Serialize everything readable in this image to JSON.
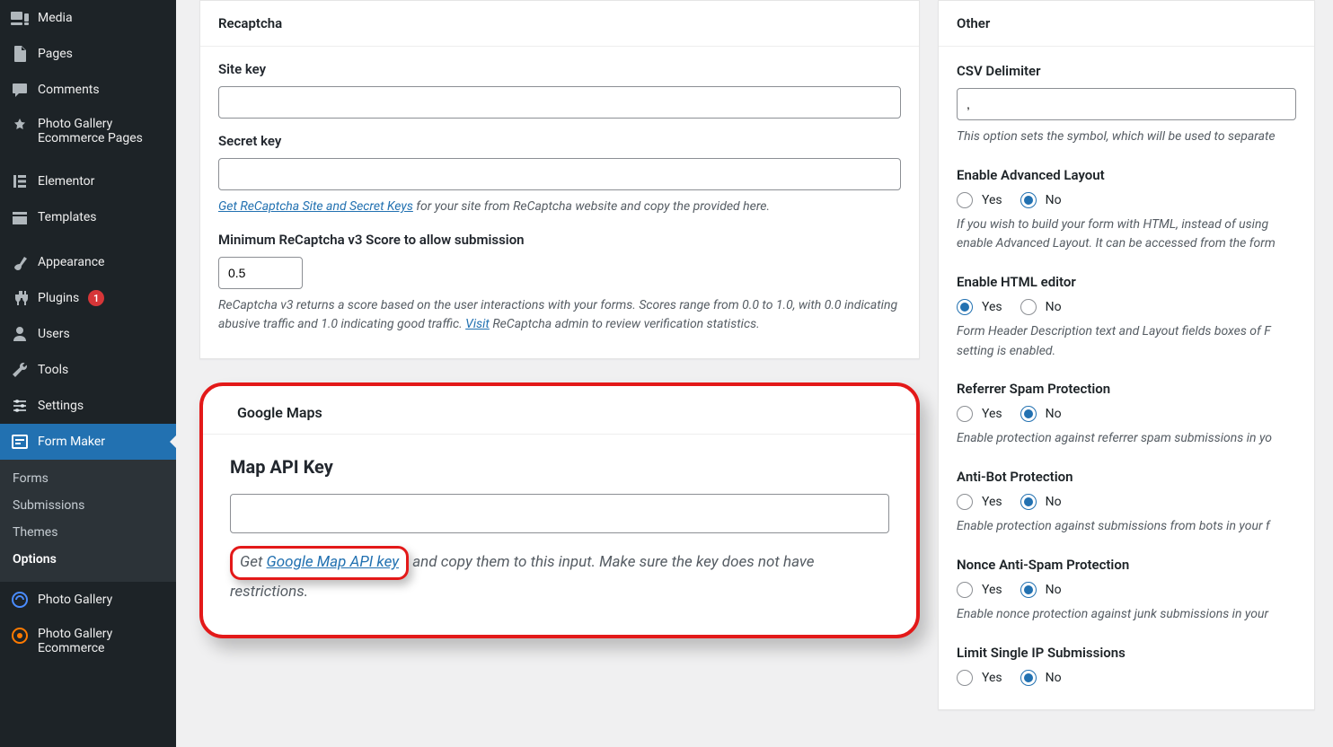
{
  "sidebar": {
    "items": [
      {
        "label": "Media"
      },
      {
        "label": "Pages"
      },
      {
        "label": "Comments"
      },
      {
        "label": "Photo Gallery Ecommerce Pages"
      },
      {
        "label": "Elementor"
      },
      {
        "label": "Templates"
      },
      {
        "label": "Appearance"
      },
      {
        "label": "Plugins",
        "badge": "1"
      },
      {
        "label": "Users"
      },
      {
        "label": "Tools"
      },
      {
        "label": "Settings"
      },
      {
        "label": "Form Maker"
      },
      {
        "label": "Photo Gallery"
      },
      {
        "label": "Photo Gallery Ecommerce"
      }
    ],
    "sub": [
      {
        "label": "Forms"
      },
      {
        "label": "Submissions"
      },
      {
        "label": "Themes"
      },
      {
        "label": "Options"
      }
    ]
  },
  "recaptcha": {
    "title": "Recaptcha",
    "site_key_label": "Site key",
    "site_key": "",
    "secret_key_label": "Secret key",
    "secret_key": "",
    "keys_link": "Get ReCaptcha Site and Secret Keys",
    "keys_after": " for your site from ReCaptcha website and copy the provided here.",
    "score_label": "Minimum ReCaptcha v3 Score to allow submission",
    "score": "0.5",
    "score_hint_1": "ReCaptcha v3 returns a score based on the user interactions with your forms. Scores range from 0.0 to 1.0, with 0.0 indicating abusive traffic and 1.0 indicating good traffic. ",
    "score_visit": "Visit",
    "score_hint_2": " ReCaptcha admin to review verification statistics."
  },
  "maps": {
    "title": "Google Maps",
    "api_label": "Map API Key",
    "api_value": "",
    "hint_pre": "Get ",
    "hint_link": "Google Map API key",
    "hint_post": " and copy them to this input. Make sure the key does not have restrictions."
  },
  "other": {
    "title": "Other",
    "csv_label": "CSV Delimiter",
    "csv_value": ",",
    "csv_hint": "This option sets the symbol, which will be used to separate",
    "adv_label": "Enable Advanced Layout",
    "adv_value": "No",
    "adv_hint": "If you wish to build your form with HTML, instead of using enable Advanced Layout. It can be accessed from the form",
    "html_label": "Enable HTML editor",
    "html_value": "Yes",
    "html_hint": "Form Header Description text and Layout fields boxes of F setting is enabled.",
    "ref_label": "Referrer Spam Protection",
    "ref_value": "No",
    "ref_hint": "Enable protection against referrer spam submissions in yo",
    "bot_label": "Anti-Bot Protection",
    "bot_value": "No",
    "bot_hint": "Enable protection against submissions from bots in your f",
    "nonce_label": "Nonce Anti-Spam Protection",
    "nonce_value": "No",
    "nonce_hint": "Enable nonce protection against junk submissions in your",
    "limit_label": "Limit Single IP Submissions",
    "limit_value": "No",
    "yes": "Yes",
    "no": "No"
  }
}
